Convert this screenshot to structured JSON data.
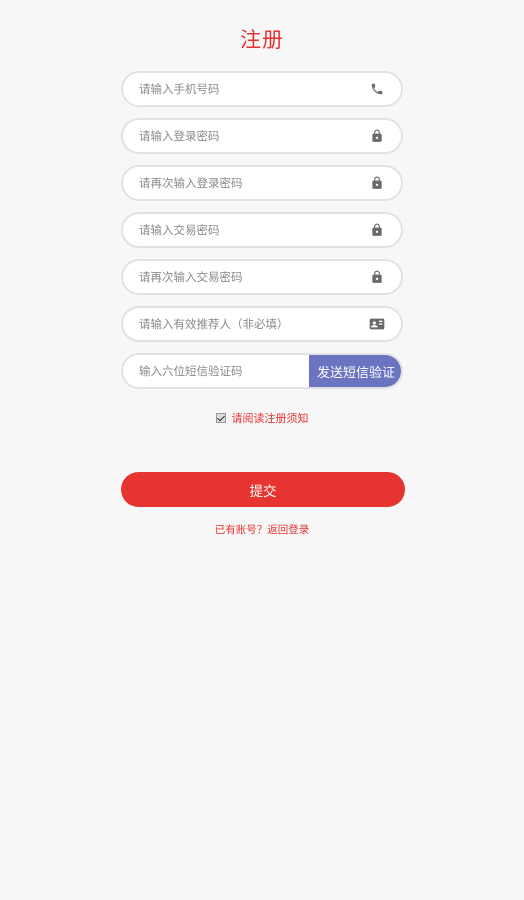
{
  "page": {
    "title": "注册"
  },
  "form": {
    "phone": {
      "placeholder": "请输入手机号码",
      "icon": "phone-icon"
    },
    "login_password": {
      "placeholder": "请输入登录密码",
      "icon": "lock-icon"
    },
    "login_password_confirm": {
      "placeholder": "请再次输入登录密码",
      "icon": "lock-icon"
    },
    "trade_password": {
      "placeholder": "请输入交易密码",
      "icon": "lock-icon"
    },
    "trade_password_confirm": {
      "placeholder": "请再次输入交易密码",
      "icon": "lock-icon"
    },
    "referrer": {
      "placeholder": "请输入有效推荐人（非必填）",
      "icon": "id-card-icon"
    },
    "sms_code": {
      "placeholder": "输入六位短信验证码",
      "button_label": "发送短信验证"
    }
  },
  "agreement": {
    "checked": true,
    "label": "请阅读注册须知"
  },
  "submit": {
    "label": "提交"
  },
  "login_link": {
    "label": "已有账号？返回登录"
  },
  "colors": {
    "accent": "#e63530",
    "sms_button": "#6b74c0",
    "icon": "#6a6a6a"
  }
}
